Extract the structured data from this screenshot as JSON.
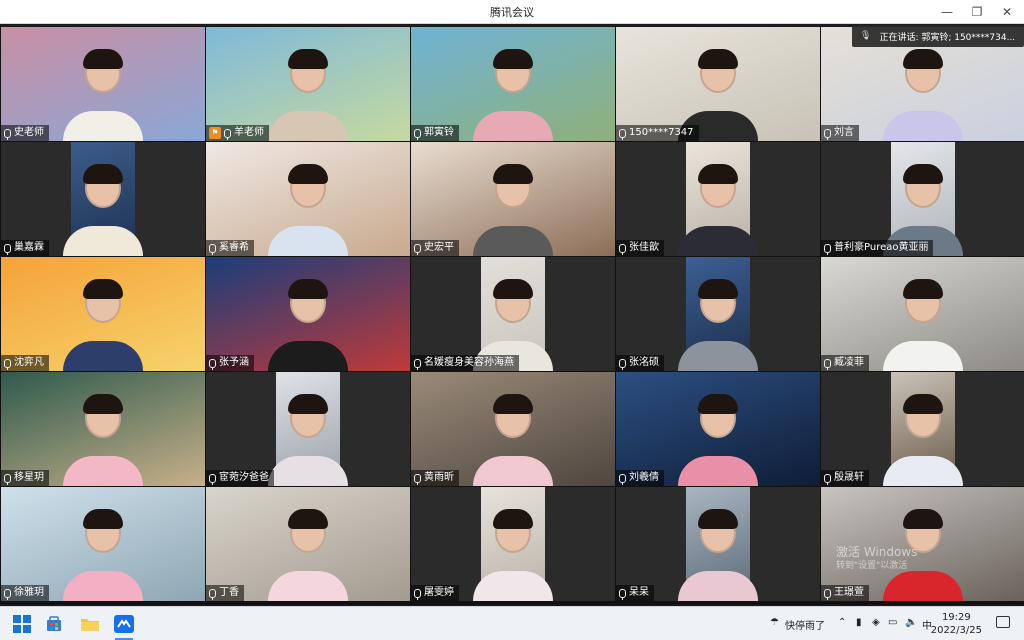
{
  "window": {
    "title": "腾讯会议"
  },
  "speaker_notice": {
    "text": "正在讲话: 郭寅铃; 150****734..."
  },
  "participants": [
    {
      "name": "史老师",
      "mic": true,
      "host": false,
      "layout": "full",
      "bg": "#c98fa3",
      "bg2": "#8aa7d6",
      "shirt": "#f2efe8"
    },
    {
      "name": "羊老师",
      "mic": true,
      "host": true,
      "layout": "full",
      "bg": "#7fb9d8",
      "bg2": "#c6d9a0",
      "shirt": "#d8c6b4"
    },
    {
      "name": "郭寅铃",
      "mic": true,
      "host": false,
      "layout": "full",
      "bg": "#6fb3d4",
      "bg2": "#8fb07a",
      "shirt": "#e8a9b7"
    },
    {
      "name": "150****7347",
      "mic": true,
      "host": false,
      "layout": "full",
      "bg": "#e8e4dc",
      "bg2": "#c8c2b6",
      "shirt": "#2a2a2a"
    },
    {
      "name": "刘言",
      "mic": true,
      "host": false,
      "layout": "full",
      "bg": "#e6e0d6",
      "bg2": "#c9d0df",
      "shirt": "#c9c6ea"
    },
    {
      "name": "巢嘉霖",
      "mic": true,
      "host": false,
      "layout": "narrow",
      "bg": "#3b5d8a",
      "bg2": "#1f3050",
      "shirt": "#f0e8d8"
    },
    {
      "name": "奚睿希",
      "mic": true,
      "host": false,
      "layout": "full",
      "bg": "#efe8e4",
      "bg2": "#c8a98d",
      "shirt": "#d9e3ef"
    },
    {
      "name": "史宏平",
      "mic": true,
      "host": false,
      "layout": "full",
      "bg": "#e9ddd0",
      "bg2": "#8c6e58",
      "shirt": "#5a5a5a"
    },
    {
      "name": "张佳歆",
      "mic": true,
      "host": false,
      "layout": "narrow",
      "bg": "#eae4da",
      "bg2": "#b8b0a6",
      "shirt": "#2c2c36"
    },
    {
      "name": "普利豪Pureao黄亚丽",
      "mic": true,
      "host": false,
      "layout": "narrow",
      "bg": "#e4e6e8",
      "bg2": "#aeb4ba",
      "shirt": "#6c7a88"
    },
    {
      "name": "沈弈凡",
      "mic": true,
      "host": false,
      "layout": "full",
      "bg": "#f5a23a",
      "bg2": "#f6d36b",
      "shirt": "#2d3e6a"
    },
    {
      "name": "张予涵",
      "mic": true,
      "host": false,
      "layout": "full",
      "bg": "#1b3d7a",
      "bg2": "#c03a3a",
      "shirt": "#1c1c1c"
    },
    {
      "name": "名媛瘦身美容孙海燕",
      "mic": true,
      "host": false,
      "layout": "narrow",
      "bg": "#e2dfda",
      "bg2": "#c9c4bd",
      "shirt": "#e9e6de"
    },
    {
      "name": "张洺硕",
      "mic": true,
      "host": false,
      "layout": "narrow",
      "bg": "#3c5f92",
      "bg2": "#1e2e4a",
      "shirt": "#8c939c"
    },
    {
      "name": "臧凌菲",
      "mic": true,
      "host": false,
      "layout": "full",
      "bg": "#d9d8d4",
      "bg2": "#8d8a84",
      "shirt": "#f2f2f0"
    },
    {
      "name": "移星玥",
      "mic": true,
      "host": false,
      "layout": "full",
      "bg": "#2f5a4e",
      "bg2": "#c7b089",
      "shirt": "#f2b8c6"
    },
    {
      "name": "宦菀汐爸爸",
      "mic": true,
      "host": false,
      "layout": "narrow",
      "bg": "#dfe2e6",
      "bg2": "#9aa0a8",
      "shirt": "#e6dfe3"
    },
    {
      "name": "黄雨昕",
      "mic": true,
      "host": false,
      "layout": "full",
      "bg": "#9a8a78",
      "bg2": "#4e4640",
      "shirt": "#f0c8d2"
    },
    {
      "name": "刘羲倩",
      "mic": true,
      "host": false,
      "layout": "full",
      "bg": "#2c4f82",
      "bg2": "#0f1d36",
      "shirt": "#e98fa6"
    },
    {
      "name": "殷晟轩",
      "mic": true,
      "host": false,
      "layout": "narrow",
      "bg": "#c9c3b8",
      "bg2": "#6b5a48",
      "shirt": "#e8ecf2"
    },
    {
      "name": "徐雅玥",
      "mic": true,
      "host": false,
      "layout": "full",
      "bg": "#cfe0ea",
      "bg2": "#8ea6b4",
      "shirt": "#f3b0c4"
    },
    {
      "name": "丁香",
      "mic": true,
      "host": false,
      "layout": "full",
      "bg": "#d9d4cc",
      "bg2": "#a39b90",
      "shirt": "#f4d6de"
    },
    {
      "name": "屠雯婷",
      "mic": true,
      "host": false,
      "layout": "narrow",
      "bg": "#e6e2dc",
      "bg2": "#b9b2a8",
      "shirt": "#f1e6ea"
    },
    {
      "name": "呆呆",
      "mic": true,
      "host": false,
      "layout": "narrow",
      "bg": "#a8b6c2",
      "bg2": "#5c6a78",
      "shirt": "#e9c8d4"
    },
    {
      "name": "王璟萱",
      "mic": true,
      "host": false,
      "layout": "full",
      "bg": "#c8c4c0",
      "bg2": "#6a625c",
      "shirt": "#d8262c"
    }
  ],
  "watermark": {
    "line1": "激活 Windows",
    "line2": "转到\"设置\"以激活"
  },
  "taskbar": {
    "tray_label": "快停雨了",
    "time": "19:29",
    "date": "2022/3/25",
    "ime": "中"
  }
}
